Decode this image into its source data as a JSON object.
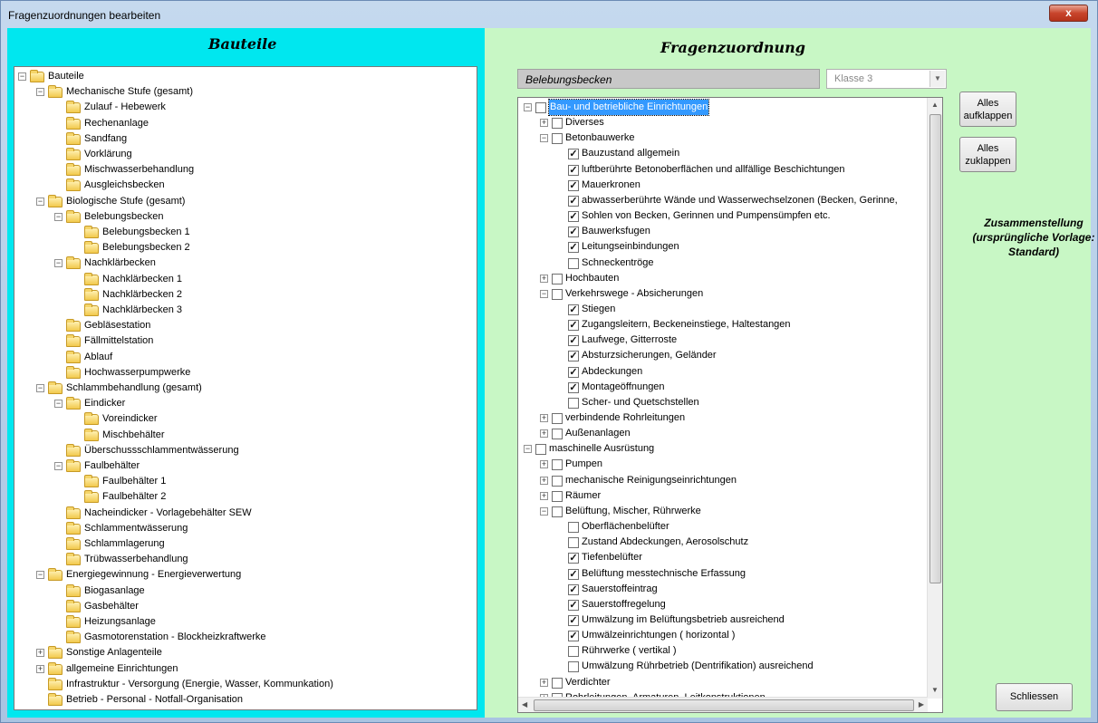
{
  "window": {
    "title": "Fragenzuordnungen bearbeiten",
    "close_label": "x"
  },
  "left": {
    "title": "Bauteile",
    "tree": [
      {
        "text": "Bauteile",
        "level": 0,
        "exp": "-"
      },
      {
        "text": "Mechanische Stufe (gesamt)",
        "level": 1,
        "exp": "-"
      },
      {
        "text": "Zulauf - Hebewerk",
        "level": 2,
        "exp": ""
      },
      {
        "text": "Rechenanlage",
        "level": 2,
        "exp": ""
      },
      {
        "text": "Sandfang",
        "level": 2,
        "exp": ""
      },
      {
        "text": "Vorklärung",
        "level": 2,
        "exp": ""
      },
      {
        "text": "Mischwasserbehandlung",
        "level": 2,
        "exp": ""
      },
      {
        "text": "Ausgleichsbecken",
        "level": 2,
        "exp": ""
      },
      {
        "text": "Biologische Stufe (gesamt)",
        "level": 1,
        "exp": "-"
      },
      {
        "text": "Belebungsbecken",
        "level": 2,
        "exp": "-"
      },
      {
        "text": "Belebungsbecken 1",
        "level": 3,
        "exp": ""
      },
      {
        "text": "Belebungsbecken 2",
        "level": 3,
        "exp": ""
      },
      {
        "text": "Nachklärbecken",
        "level": 2,
        "exp": "-"
      },
      {
        "text": "Nachklärbecken 1",
        "level": 3,
        "exp": ""
      },
      {
        "text": "Nachklärbecken 2",
        "level": 3,
        "exp": ""
      },
      {
        "text": "Nachklärbecken 3",
        "level": 3,
        "exp": ""
      },
      {
        "text": "Gebläsestation",
        "level": 2,
        "exp": ""
      },
      {
        "text": "Fällmittelstation",
        "level": 2,
        "exp": ""
      },
      {
        "text": "Ablauf",
        "level": 2,
        "exp": ""
      },
      {
        "text": "Hochwasserpumpwerke",
        "level": 2,
        "exp": ""
      },
      {
        "text": "Schlammbehandlung (gesamt)",
        "level": 1,
        "exp": "-"
      },
      {
        "text": "Eindicker",
        "level": 2,
        "exp": "-"
      },
      {
        "text": "Voreindicker",
        "level": 3,
        "exp": ""
      },
      {
        "text": "Mischbehälter",
        "level": 3,
        "exp": ""
      },
      {
        "text": "Überschussschlammentwässerung",
        "level": 2,
        "exp": ""
      },
      {
        "text": "Faulbehälter",
        "level": 2,
        "exp": "-"
      },
      {
        "text": "Faulbehälter 1",
        "level": 3,
        "exp": ""
      },
      {
        "text": "Faulbehälter 2",
        "level": 3,
        "exp": ""
      },
      {
        "text": "Nacheindicker - Vorlagebehälter SEW",
        "level": 2,
        "exp": ""
      },
      {
        "text": "Schlammentwässerung",
        "level": 2,
        "exp": ""
      },
      {
        "text": "Schlammlagerung",
        "level": 2,
        "exp": ""
      },
      {
        "text": "Trübwasserbehandlung",
        "level": 2,
        "exp": ""
      },
      {
        "text": "Energiegewinnung - Energieverwertung",
        "level": 1,
        "exp": "-"
      },
      {
        "text": "Biogasanlage",
        "level": 2,
        "exp": ""
      },
      {
        "text": "Gasbehälter",
        "level": 2,
        "exp": ""
      },
      {
        "text": "Heizungsanlage",
        "level": 2,
        "exp": ""
      },
      {
        "text": "Gasmotorenstation - Blockheizkraftwerke",
        "level": 2,
        "exp": ""
      },
      {
        "text": "Sonstige Anlagenteile",
        "level": 1,
        "exp": "+"
      },
      {
        "text": "allgemeine Einrichtungen",
        "level": 1,
        "exp": "+"
      },
      {
        "text": "Infrastruktur - Versorgung (Energie, Wasser, Kommunkation)",
        "level": 1,
        "exp": ""
      },
      {
        "text": "Betrieb - Personal - Notfall-Organisation",
        "level": 1,
        "exp": ""
      }
    ]
  },
  "right": {
    "title": "Fragenzuordnung",
    "selected_bauteil": "Belebungsbecken",
    "class_value": "Klasse 3",
    "tree": [
      {
        "text": "Bau- und betriebliche Einrichtungen",
        "level": 0,
        "exp": "-",
        "checked": false,
        "selected": true
      },
      {
        "text": "Diverses",
        "level": 1,
        "exp": "+",
        "checked": false
      },
      {
        "text": "Betonbauwerke",
        "level": 1,
        "exp": "-",
        "checked": false
      },
      {
        "text": "Bauzustand allgemein",
        "level": 2,
        "exp": "",
        "checked": true
      },
      {
        "text": "luftberührte Betonoberflächen und allfällige Beschichtungen",
        "level": 2,
        "exp": "",
        "checked": true
      },
      {
        "text": "Mauerkronen",
        "level": 2,
        "exp": "",
        "checked": true
      },
      {
        "text": "abwasserberührte Wände und Wasserwechselzonen (Becken, Gerinne,",
        "level": 2,
        "exp": "",
        "checked": true
      },
      {
        "text": "Sohlen von Becken, Gerinnen und Pumpensümpfen etc.",
        "level": 2,
        "exp": "",
        "checked": true
      },
      {
        "text": "Bauwerksfugen",
        "level": 2,
        "exp": "",
        "checked": true
      },
      {
        "text": "Leitungseinbindungen",
        "level": 2,
        "exp": "",
        "checked": true
      },
      {
        "text": "Schneckentröge",
        "level": 2,
        "exp": "",
        "checked": false
      },
      {
        "text": "Hochbauten",
        "level": 1,
        "exp": "+",
        "checked": false
      },
      {
        "text": "Verkehrswege - Absicherungen",
        "level": 1,
        "exp": "-",
        "checked": false
      },
      {
        "text": "Stiegen",
        "level": 2,
        "exp": "",
        "checked": true
      },
      {
        "text": "Zugangsleitern, Beckeneinstiege, Haltestangen",
        "level": 2,
        "exp": "",
        "checked": true
      },
      {
        "text": "Laufwege, Gitterroste",
        "level": 2,
        "exp": "",
        "checked": true
      },
      {
        "text": "Absturzsicherungen, Geländer",
        "level": 2,
        "exp": "",
        "checked": true
      },
      {
        "text": "Abdeckungen",
        "level": 2,
        "exp": "",
        "checked": true
      },
      {
        "text": "Montageöffnungen",
        "level": 2,
        "exp": "",
        "checked": true
      },
      {
        "text": "Scher- und Quetschstellen",
        "level": 2,
        "exp": "",
        "checked": false
      },
      {
        "text": "verbindende Rohrleitungen",
        "level": 1,
        "exp": "+",
        "checked": false
      },
      {
        "text": "Außenanlagen",
        "level": 1,
        "exp": "+",
        "checked": false
      },
      {
        "text": "maschinelle Ausrüstung",
        "level": 0,
        "exp": "-",
        "checked": false
      },
      {
        "text": "Pumpen",
        "level": 1,
        "exp": "+",
        "checked": false
      },
      {
        "text": "mechanische Reinigungseinrichtungen",
        "level": 1,
        "exp": "+",
        "checked": false
      },
      {
        "text": "Räumer",
        "level": 1,
        "exp": "+",
        "checked": false
      },
      {
        "text": "Belüftung, Mischer, Rührwerke",
        "level": 1,
        "exp": "-",
        "checked": false
      },
      {
        "text": "Oberflächenbelüfter",
        "level": 2,
        "exp": "",
        "checked": false
      },
      {
        "text": "Zustand Abdeckungen, Aerosolschutz",
        "level": 2,
        "exp": "",
        "checked": false
      },
      {
        "text": "Tiefenbelüfter",
        "level": 2,
        "exp": "",
        "checked": true
      },
      {
        "text": "Belüftung messtechnische Erfassung",
        "level": 2,
        "exp": "",
        "checked": true
      },
      {
        "text": "Sauerstoffeintrag",
        "level": 2,
        "exp": "",
        "checked": true
      },
      {
        "text": "Sauerstoffregelung",
        "level": 2,
        "exp": "",
        "checked": true
      },
      {
        "text": "Umwälzung im Belüftungsbetrieb ausreichend",
        "level": 2,
        "exp": "",
        "checked": true
      },
      {
        "text": "Umwälzeinrichtungen ( horizontal )",
        "level": 2,
        "exp": "",
        "checked": true
      },
      {
        "text": "Rührwerke ( vertikal )",
        "level": 2,
        "exp": "",
        "checked": false
      },
      {
        "text": "Umwälzung Rührbetrieb (Dentrifikation) ausreichend",
        "level": 2,
        "exp": "",
        "checked": false
      },
      {
        "text": "Verdichter",
        "level": 1,
        "exp": "+",
        "checked": false
      },
      {
        "text": "Rohrleitungen, Armaturen, Leitkonstruktionen",
        "level": 1,
        "exp": "+",
        "checked": false
      }
    ]
  },
  "buttons": {
    "expand_all": "Alles aufklappen",
    "collapse_all": "Alles zuklappen",
    "close": "Schliessen"
  },
  "summary": "Zusammenstellung (ursprüngliche Vorlage: Standard)"
}
